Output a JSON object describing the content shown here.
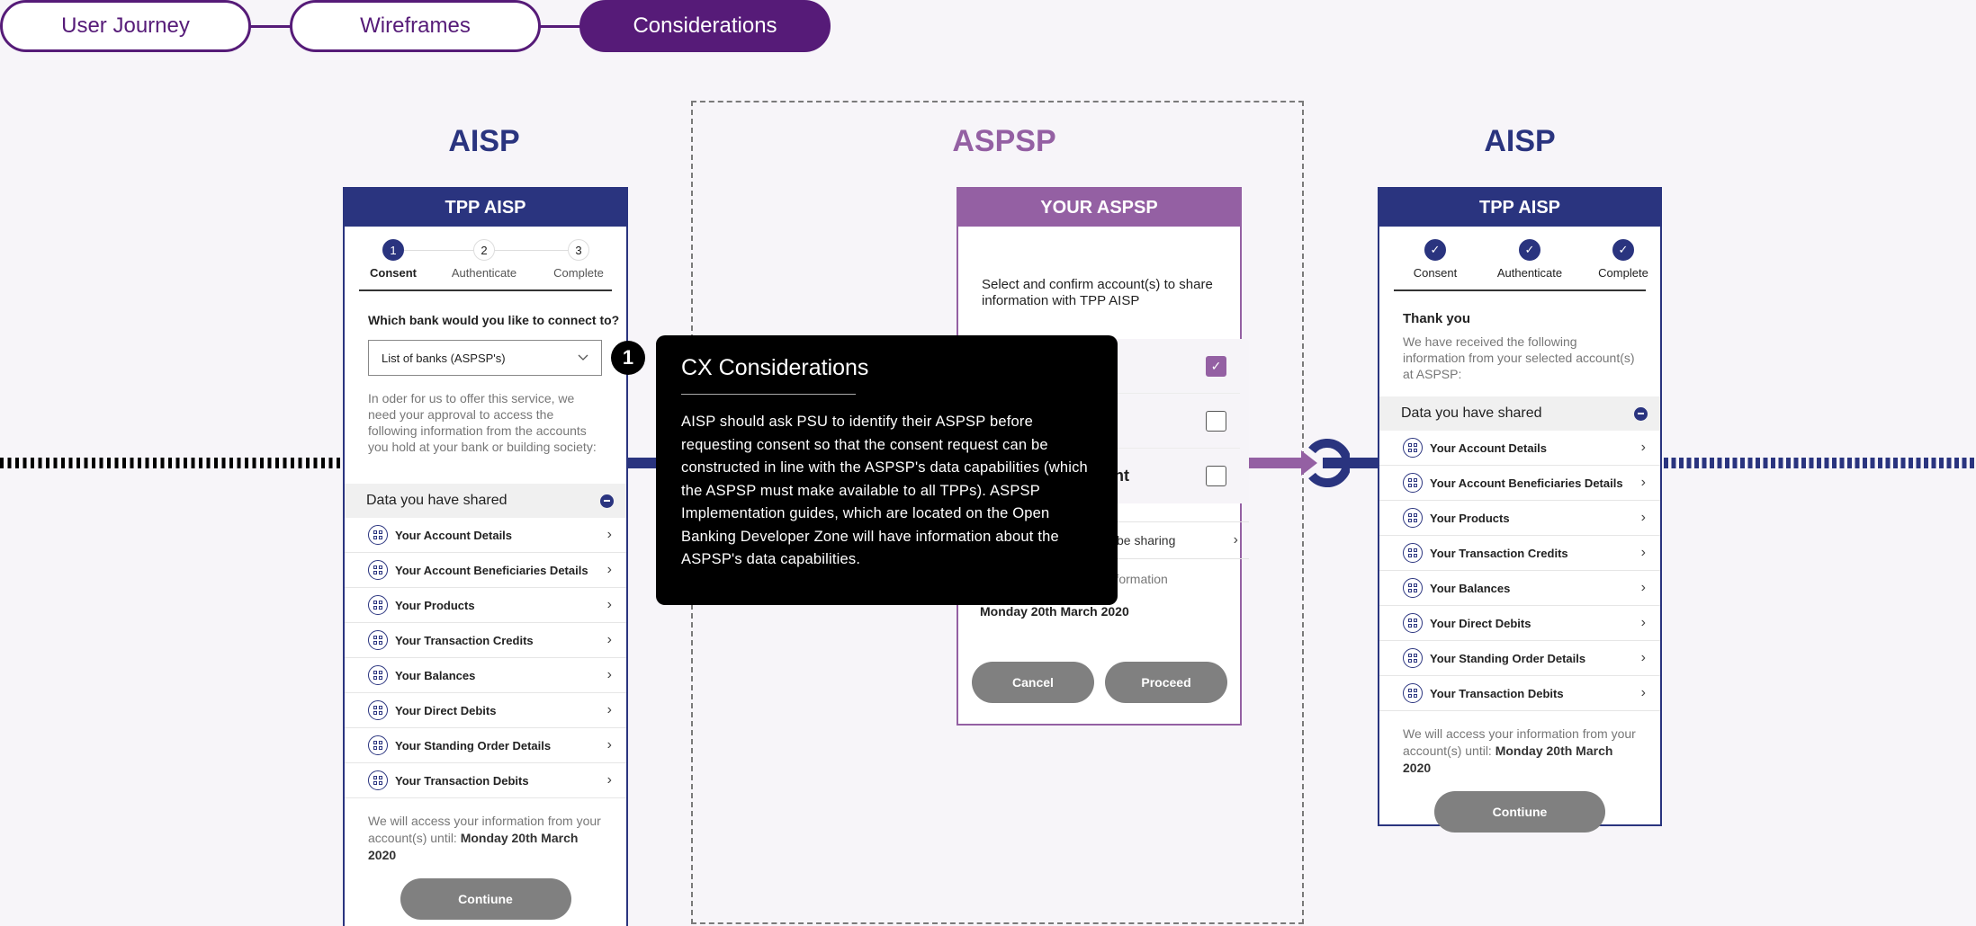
{
  "nav": {
    "tabs": [
      {
        "label": "User Journey",
        "active": false
      },
      {
        "label": "Wireframes",
        "active": false
      },
      {
        "label": "Considerations",
        "active": true
      }
    ]
  },
  "colors": {
    "aisp_blue": "#2a347f",
    "aspsp_purple": "#9460a3",
    "nav_purple": "#561b78",
    "button_grey": "#808080"
  },
  "columns": {
    "left_heading": "AISP",
    "middle_heading": "ASPSP",
    "right_heading": "AISP"
  },
  "left_phone": {
    "header": "TPP AISP",
    "steps": [
      {
        "num": "1",
        "label": "Consent",
        "state": "current"
      },
      {
        "num": "2",
        "label": "Authenticate",
        "state": "pending"
      },
      {
        "num": "3",
        "label": "Complete",
        "state": "pending"
      }
    ],
    "question": "Which bank would you like to connect to?",
    "select_value": "List of banks (ASPSP's)",
    "intro": "In oder for us to offer this service, we need your approval to access the following information from the accounts you hold at your bank or building society:",
    "section_title": "Data you have shared",
    "items": [
      "Your Account Details",
      "Your Account Beneficiaries Details",
      "Your Products",
      "Your Transaction Credits",
      "Your Balances",
      "Your Direct Debits",
      "Your Standing Order Details",
      "Your Transaction Debits"
    ],
    "footer_prefix": "We will access your information from your account(s) until: ",
    "footer_date": "Monday 20th March 2020",
    "button": "Contiune"
  },
  "middle_phone": {
    "header": "YOUR ASPSP",
    "instruction": "Select and confirm account(s) to share information with TPP AISP",
    "accounts": [
      {
        "label": "",
        "checked": true
      },
      {
        "label": "",
        "checked": false
      },
      {
        "label": "nt",
        "checked": false
      }
    ],
    "sharing_link": "be sharing",
    "access_partial_1": "r information",
    "access_partial_2": "il:",
    "access_date": "Monday 20th March 2020",
    "cancel": "Cancel",
    "proceed": "Proceed"
  },
  "right_phone": {
    "header": "TPP AISP",
    "steps": [
      {
        "label": "Consent",
        "state": "done"
      },
      {
        "label": "Authenticate",
        "state": "done"
      },
      {
        "label": "Complete",
        "state": "done"
      }
    ],
    "title": "Thank you",
    "intro": "We have received the following information from your selected account(s) at ASPSP:",
    "section_title": "Data you have shared",
    "items": [
      "Your Account Details",
      "Your Account Beneficiaries Details",
      "Your Products",
      "Your Transaction Credits",
      "Your Balances",
      "Your Direct Debits",
      "Your Standing Order Details",
      "Your Transaction Debits"
    ],
    "footer_prefix": "We will access your information from your account(s) until: ",
    "footer_date": "Monday 20th March 2020",
    "button": "Contiune"
  },
  "callout": {
    "number": "1",
    "title": "CX Considerations",
    "body": "AISP should ask PSU to identify their ASPSP before requesting consent so that the consent request can be constructed in line with the ASPSP's data capabilities (which the ASPSP must make available to all TPPs). ASPSP Implementation guides, which are located on the Open Banking Developer Zone will have information about the ASPSP's data capabilities."
  }
}
